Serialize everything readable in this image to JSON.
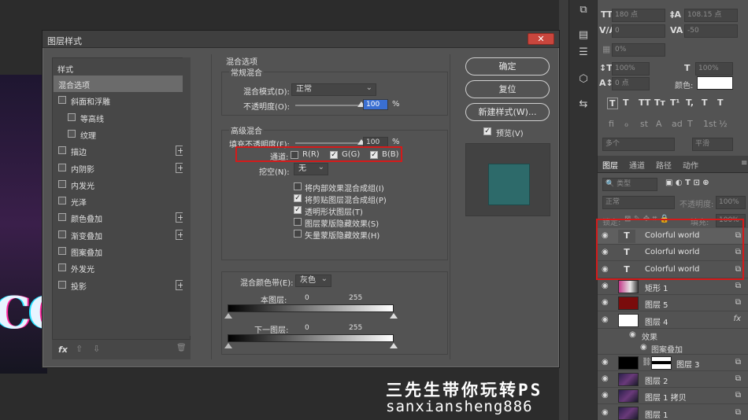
{
  "dialog": {
    "title": "图层样式",
    "close_label": "✕",
    "style_list": {
      "header": "样式",
      "items": [
        {
          "label": "混合选项",
          "checkbox": false,
          "plus": false,
          "active": true
        },
        {
          "label": "斜面和浮雕",
          "checkbox": true,
          "plus": false
        },
        {
          "label": "等高线",
          "checkbox": true,
          "plus": false,
          "indent": true
        },
        {
          "label": "纹理",
          "checkbox": true,
          "plus": false,
          "indent": true
        },
        {
          "label": "描边",
          "checkbox": true,
          "plus": true
        },
        {
          "label": "内阴影",
          "checkbox": true,
          "plus": true
        },
        {
          "label": "内发光",
          "checkbox": true,
          "plus": false
        },
        {
          "label": "光泽",
          "checkbox": true,
          "plus": false
        },
        {
          "label": "颜色叠加",
          "checkbox": true,
          "plus": true
        },
        {
          "label": "渐变叠加",
          "checkbox": true,
          "plus": true
        },
        {
          "label": "图案叠加",
          "checkbox": true,
          "plus": false
        },
        {
          "label": "外发光",
          "checkbox": true,
          "plus": false
        },
        {
          "label": "投影",
          "checkbox": true,
          "plus": true
        }
      ],
      "footer_fx": "fx",
      "footer_up": "⇧",
      "footer_down": "⇩",
      "footer_trash": "🗑"
    },
    "blend": {
      "section_title": "混合选项",
      "normal_group": "常规混合",
      "blend_mode_label": "混合模式(D):",
      "blend_mode_value": "正常",
      "opacity_label": "不透明度(O):",
      "opacity_value": "100",
      "opacity_unit": "%",
      "opacity_level": 1.0,
      "advanced_group": "高级混合",
      "fill_opacity_label": "填充不透明度(F):",
      "fill_opacity_value": "100",
      "fill_opacity_unit": "%",
      "fill_opacity_level": 1.0,
      "channels_label": "通道:",
      "channel_r": "R(R)",
      "channel_g": "G(G)",
      "channel_b": "B(B)",
      "knockout_label": "挖空(N):",
      "knockout_value": "无",
      "options": [
        {
          "label": "将内部效果混合成组(I)",
          "checked": false
        },
        {
          "label": "将剪贴图层混合成组(P)",
          "checked": true
        },
        {
          "label": "透明形状图层(T)",
          "checked": true
        },
        {
          "label": "图层蒙版隐藏效果(S)",
          "checked": false
        },
        {
          "label": "矢量蒙版隐藏效果(H)",
          "checked": false
        }
      ],
      "blend_if_label": "混合颜色带(E):",
      "blend_if_value": "灰色",
      "this_layer_label": "本图层:",
      "this_layer_min": "0",
      "this_layer_max": "255",
      "underlying_label": "下一图层:",
      "underlying_min": "0",
      "underlying_max": "255"
    },
    "buttons": {
      "ok": "确定",
      "reset": "复位",
      "new_style": "新建样式(W)...",
      "preview_label": "预览(V)"
    }
  },
  "character_panel": {
    "font_size": "180 点",
    "leading": "108.15 点",
    "kerning": "0",
    "tracking": "-50",
    "baseline_shift_pct": "0%",
    "vert_scale": "100%",
    "horiz_scale": "100%",
    "baseline": "0 点",
    "color_label": "颜色:",
    "lang": "多个",
    "aa": "平滑",
    "style_buttons": [
      "T",
      "T",
      "TT",
      "Tт",
      "T¹",
      "T,",
      "T",
      "T"
    ],
    "ot_buttons": [
      "fi",
      "ℴ",
      "st",
      "A",
      "ad",
      "T",
      "1st",
      "½"
    ]
  },
  "layers_panel": {
    "tabs": [
      "图层",
      "通道",
      "路径",
      "动作"
    ],
    "filter_label": "类型",
    "blend_mode": "正常",
    "opacity_label": "不透明度:",
    "opacity_value": "100%",
    "lock_label": "锁定:",
    "fill_label": "填充:",
    "fill_value": "100%",
    "layers": [
      {
        "name": "Colorful world",
        "type": "text",
        "selected": true
      },
      {
        "name": "Colorful world",
        "type": "text"
      },
      {
        "name": "Colorful world",
        "type": "text"
      },
      {
        "name": "矩形 1",
        "type": "shape"
      },
      {
        "name": "图层 5",
        "type": "red"
      },
      {
        "name": "图层 4",
        "type": "white",
        "fx": true
      },
      {
        "name": "图层 3",
        "type": "mask"
      },
      {
        "name": "图层 2",
        "type": "image"
      },
      {
        "name": "图层 1 拷贝",
        "type": "image"
      },
      {
        "name": "图层 1",
        "type": "image"
      }
    ],
    "effects_label": "效果",
    "pattern_overlay_label": "图案叠加",
    "fx_label": "fx"
  },
  "canvas": {
    "art_text": "CO"
  },
  "watermark": {
    "line1": "三先生带你玩转PS",
    "line2": "sanxiansheng886"
  },
  "colors": {
    "highlight_red": "#d41a1a",
    "preview_teal": "#2d6a6a",
    "selection_blue": "#3a6fd2"
  }
}
